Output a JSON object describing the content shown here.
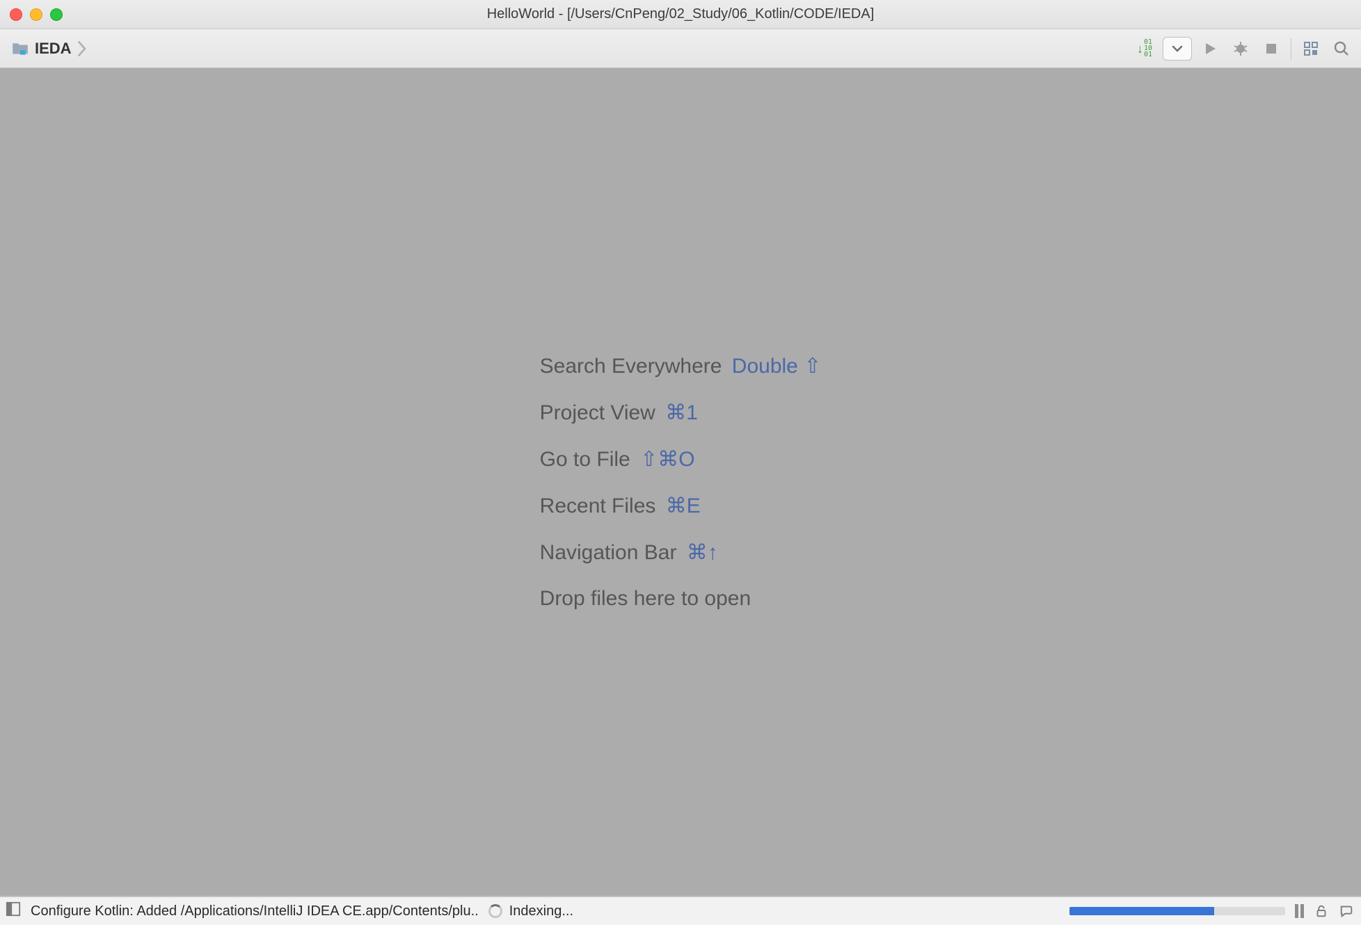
{
  "window": {
    "title": "HelloWorld - [/Users/CnPeng/02_Study/06_Kotlin/CODE/IEDA]"
  },
  "breadcrumb": {
    "project": "IEDA"
  },
  "toolbar": {
    "sort_icon": "sort-binary",
    "config_dropdown": "▾",
    "run_icon": "play",
    "debug_icon": "bug",
    "stop_icon": "stop",
    "structure_icon": "project-structure",
    "search_icon": "search"
  },
  "hints": [
    {
      "label": "Search Everywhere",
      "shortcut": "Double ⇧"
    },
    {
      "label": "Project View",
      "shortcut": "⌘1"
    },
    {
      "label": "Go to File",
      "shortcut": "⇧⌘O"
    },
    {
      "label": "Recent Files",
      "shortcut": "⌘E"
    },
    {
      "label": "Navigation Bar",
      "shortcut": "⌘↑"
    },
    {
      "label": "Drop files here to open",
      "shortcut": ""
    }
  ],
  "status": {
    "message": "Configure Kotlin: Added /Applications/IntelliJ IDEA CE.app/Contents/plu..",
    "task": "Indexing...",
    "progress_percent": 67
  }
}
